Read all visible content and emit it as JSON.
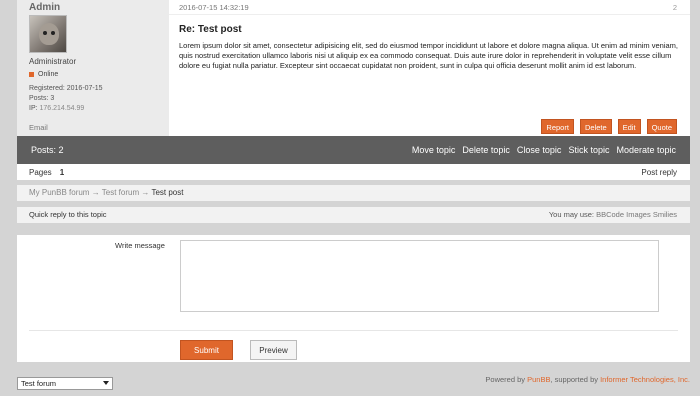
{
  "post": {
    "username": "Admin",
    "user_title": "Administrator",
    "status": "Online",
    "registered": "Registered: 2016-07-15",
    "posts": "Posts: 3",
    "ip_label": "IP:",
    "ip": "176.214.54.99",
    "email": "Email",
    "date": "2016-07-15 14:32:19",
    "number": "2",
    "title": "Re: Test post",
    "body": "Lorem ipsum dolor sit amet, consectetur adipisicing elit, sed do eiusmod tempor incididunt ut labore et dolore magna aliqua. Ut enim ad minim veniam, quis nostrud exercitation ullamco laboris nisi ut aliquip ex ea commodo consequat. Duis aute irure dolor in reprehenderit in voluptate velit esse cillum dolore eu fugiat nulla pariatur. Excepteur sint occaecat cupidatat non proident, sunt in culpa qui officia deserunt mollit anim id est laborum.",
    "actions": [
      "Report",
      "Delete",
      "Edit",
      "Quote"
    ]
  },
  "topicbar": {
    "posts": "Posts: 2",
    "mod_actions": [
      "Move topic",
      "Delete topic",
      "Close topic",
      "Stick topic",
      "Moderate topic"
    ]
  },
  "pagination": {
    "label": "Pages",
    "current": "1",
    "post_reply": "Post reply"
  },
  "breadcrumb": {
    "forum": "My PunBB forum",
    "sep": "→",
    "subforum": "Test forum",
    "topic": "Test post"
  },
  "quick_reply": {
    "title": "Quick reply to this topic",
    "you_may_use": "You may use:",
    "bbcode": "BBCode",
    "images": "Images",
    "smilies": "Smilies",
    "write_label": "Write message",
    "message_value": "",
    "submit": "Submit",
    "preview": "Preview"
  },
  "jump": {
    "selected": "Test forum"
  },
  "footer": {
    "powered_prefix": "Powered by",
    "punbb": "PunBB",
    "supported": ", supported by",
    "informer": "Informer Technologies, Inc."
  },
  "colors": {
    "accent": "#e0672c",
    "topicbar": "#5e5e5e",
    "background": "#d4d4d4"
  }
}
